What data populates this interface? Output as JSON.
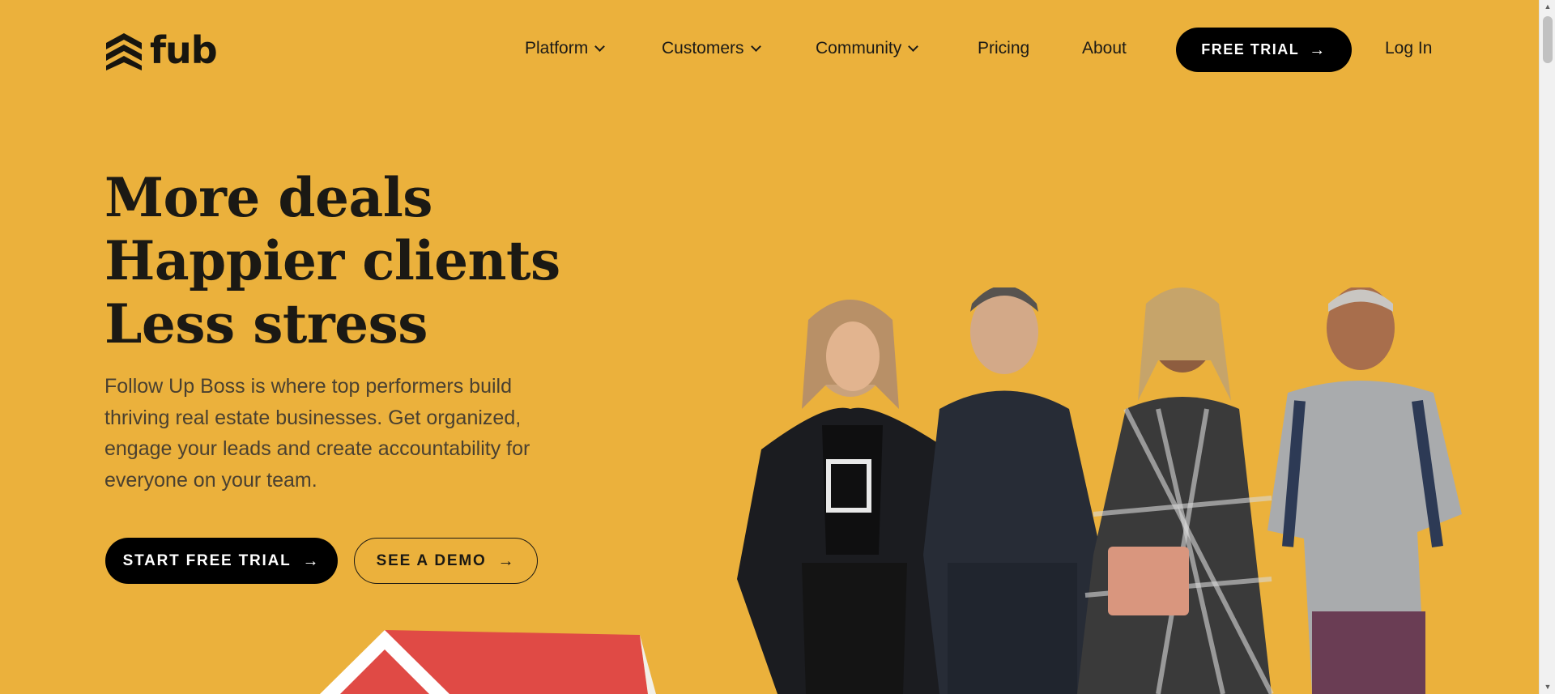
{
  "header": {
    "logo_text": "fub",
    "nav": [
      {
        "label": "Platform",
        "has_dropdown": true
      },
      {
        "label": "Customers",
        "has_dropdown": true
      },
      {
        "label": "Community",
        "has_dropdown": true
      },
      {
        "label": "Pricing",
        "has_dropdown": false
      },
      {
        "label": "About",
        "has_dropdown": false
      }
    ],
    "cta_label": "FREE TRIAL",
    "login_label": "Log In"
  },
  "hero": {
    "headline": [
      "More deals",
      "Happier clients",
      "Less stress"
    ],
    "subcopy": "Follow Up Boss is where top performers build thriving real estate businesses. Get organized, engage your leads and create accountability for everyone on your team.",
    "primary_cta": "START FREE TRIAL",
    "secondary_cta": "SEE A DEMO"
  },
  "colors": {
    "background": "#ebb13c",
    "button": "#000000",
    "text": "#1c1a16",
    "house_roof": "#e04a45"
  }
}
